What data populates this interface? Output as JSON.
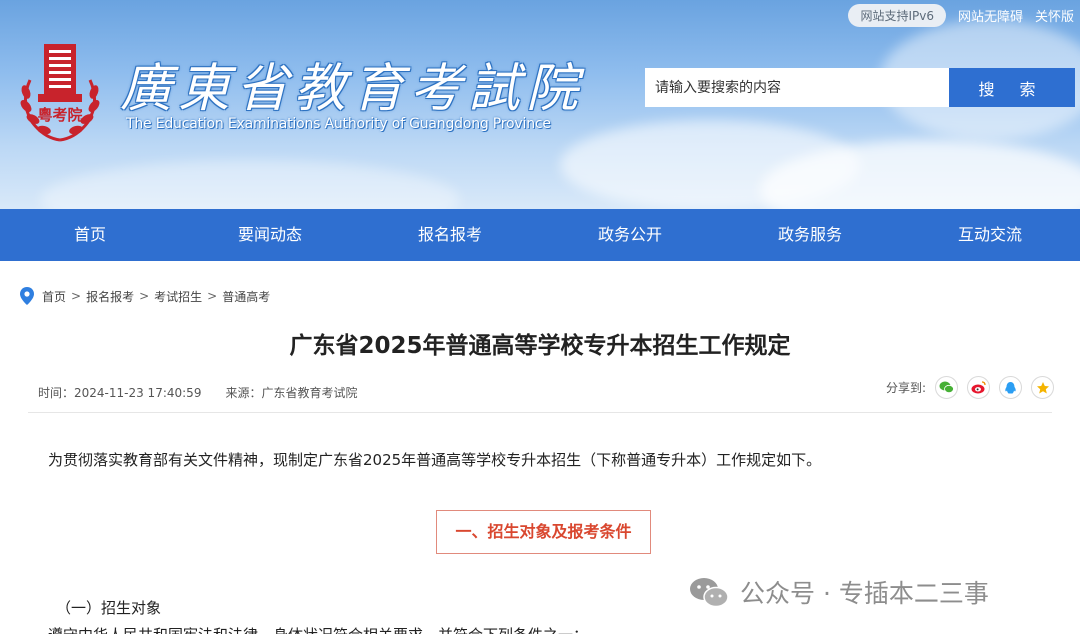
{
  "header": {
    "ipv6_label": "网站支持IPv6",
    "accessibility_label": "网站无障碍",
    "elder_mode_label": "关怀版",
    "site_title": "廣東省教育考試院",
    "site_subtitle": "The Education Examinations Authority of Guangdong Province",
    "logo_text": "粵考院",
    "search_placeholder": "请输入要搜索的内容",
    "search_button": "搜 索"
  },
  "nav": {
    "items": [
      "首页",
      "要闻动态",
      "报名报考",
      "政务公开",
      "政务服务",
      "互动交流"
    ]
  },
  "breadcrumb": {
    "items": [
      "首页",
      "报名报考",
      "考试招生",
      "普通高考"
    ],
    "separator": ">"
  },
  "article": {
    "title": "广东省2025年普通高等学校专升本招生工作规定",
    "time_label": "时间：2024-11-23 17:40:59",
    "source_label": "来源：广东省教育考试院",
    "share_label": "分享到:",
    "intro": "为贯彻落实教育部有关文件精神，现制定广东省2025年普通高等学校专升本招生（下称普通专升本）工作规定如下。",
    "section_heading": "一、招生对象及报考条件",
    "sub_heading": "（一）招生对象",
    "body_line": "遵守中华人民共和国宪法和法律，身体状况符合相关要求，并符合下列条件之一："
  },
  "share_icons": [
    "wechat-icon",
    "weibo-icon",
    "qq-icon",
    "qzone-icon"
  ],
  "watermark": {
    "text": "公众号 · 专插本二三事"
  },
  "colors": {
    "nav_bg": "#2f6fd0",
    "search_button_bg": "#2e6fd1",
    "section_accent": "#d9472f",
    "logo_red": "#c8232c"
  }
}
